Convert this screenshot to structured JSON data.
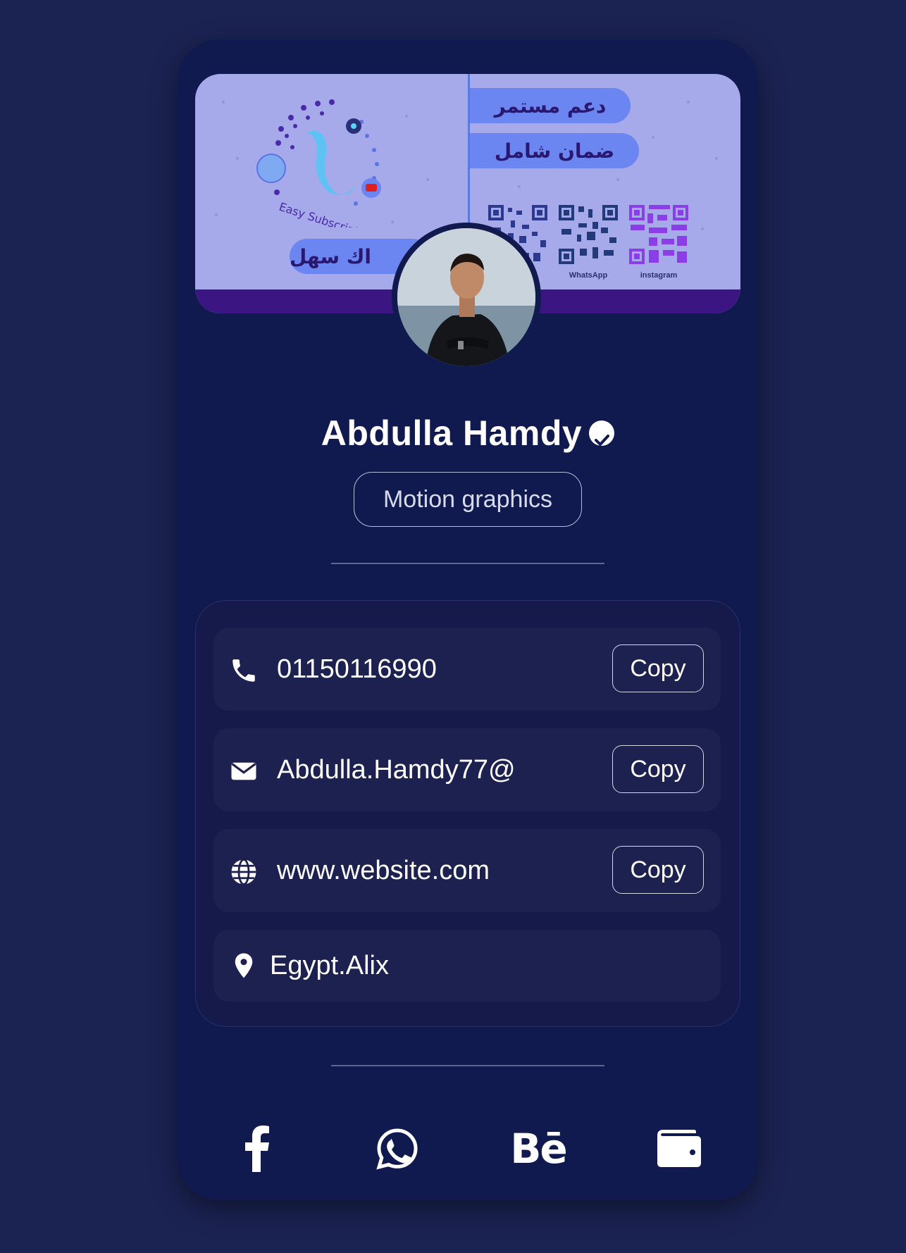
{
  "banner": {
    "arabic_line1": "دعم مستمر",
    "arabic_line2": "ضمان شامل",
    "arabic_line3": "اك سهل",
    "logo_text": "Easy Subscription",
    "qr_labels": [
      "",
      "WhatsApp",
      "instagram"
    ]
  },
  "profile": {
    "name": "Abdulla Hamdy",
    "role": "Motion graphics"
  },
  "contacts": {
    "phone": "01150116990",
    "email": "Abdulla.Hamdy77@",
    "website": "www.website.com",
    "location": "Egypt.Alix",
    "copy_label": "Copy"
  },
  "social": {
    "behance_label": "Bē"
  },
  "colors": {
    "page_bg": "#1b2353",
    "card_bg": "#111a4f",
    "banner_bg": "#a6a9ea",
    "accent": "#6b86f0"
  },
  "icons": [
    "check-circle-icon",
    "phone-icon",
    "envelope-icon",
    "globe-icon",
    "map-pin-icon",
    "facebook-icon",
    "whatsapp-icon",
    "behance-icon",
    "wallet-icon"
  ]
}
